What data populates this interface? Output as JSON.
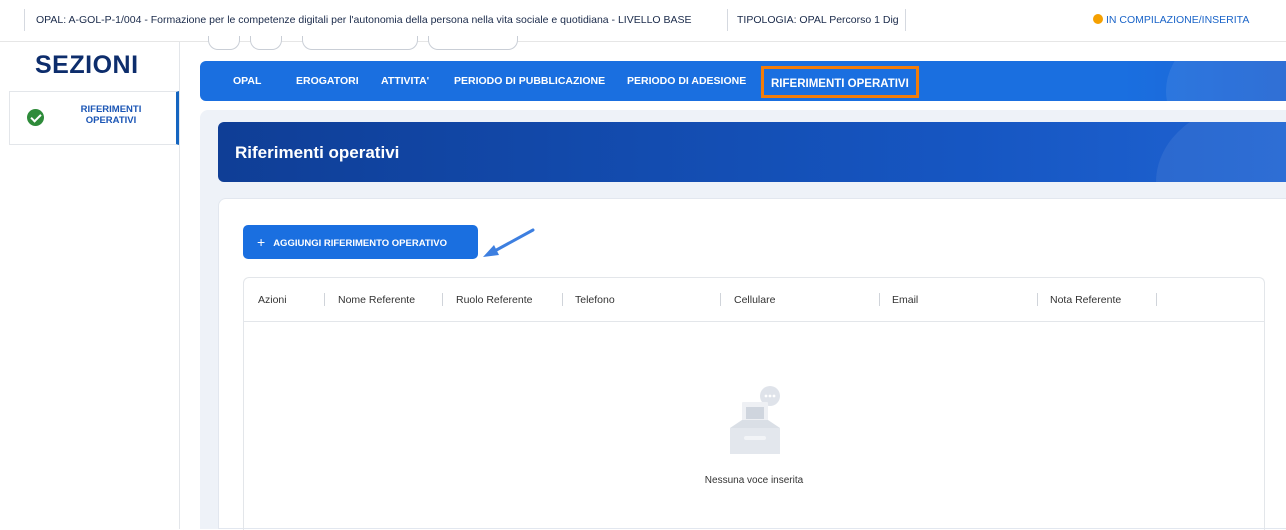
{
  "topbar": {
    "opal_info": "OPAL: A-GOL-P-1/004 - Formazione per le competenze digitali per l'autonomia della persona nella vita sociale e quotidiana - LIVELLO BASE",
    "tipologia": "TIPOLOGIA: OPAL Percorso 1 Dig",
    "status": "IN COMPILAZIONE/INSERITA",
    "status_color": "#f5a000"
  },
  "sidebar": {
    "title": "SEZIONI",
    "items": [
      {
        "label": "RIFERIMENTI OPERATIVI",
        "icon": "check-circle-icon",
        "state": "completed"
      }
    ]
  },
  "nav": {
    "tabs": [
      {
        "label": "OPAL"
      },
      {
        "label": "EROGATORI"
      },
      {
        "label": "ATTIVITA'"
      },
      {
        "label": "PERIODO DI PUBBLICAZIONE"
      },
      {
        "label": "PERIODO DI ADESIONE"
      },
      {
        "label": "RIFERIMENTI OPERATIVI",
        "active": true
      }
    ],
    "accent": "#1a6fe0",
    "highlight_color": "#f27d0c"
  },
  "main": {
    "title": "Riferimenti operativi",
    "add_button_icon": "+",
    "add_button_label": "AGGIUNGI RIFERIMENTO OPERATIVO",
    "table": {
      "columns": [
        "Azioni",
        "Nome Referente",
        "Ruolo Referente",
        "Telefono",
        "Cellulare",
        "Email",
        "Nota Referente"
      ],
      "rows": [],
      "empty_text": "Nessuna voce inserita"
    }
  }
}
